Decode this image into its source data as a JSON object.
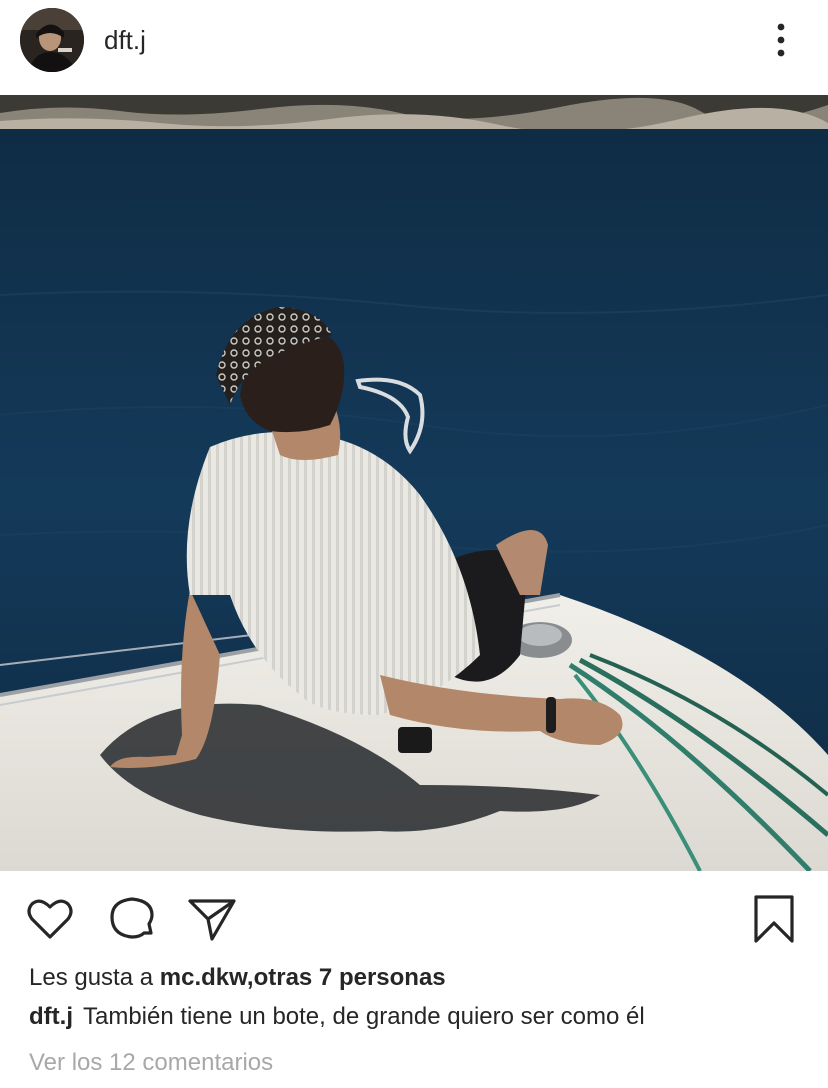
{
  "post": {
    "author": {
      "username": "dft.j",
      "avatar_icon": "profile-photo"
    },
    "menu_icon": "more-vertical-icon",
    "photo": {
      "subject": "post-photo"
    },
    "actions": {
      "like_icon": "heart-icon",
      "comment_icon": "comment-icon",
      "share_icon": "send-icon",
      "save_icon": "bookmark-icon"
    },
    "likes": {
      "prefix": "Les gusta a ",
      "first_user": "mc.dkw",
      "others": ",otras 7 personas"
    },
    "caption": {
      "username": "dft.j",
      "text": "También tiene un bote, de grande quiero ser como él"
    },
    "comments_link": "Ver los 12 comentarios"
  },
  "colors": {
    "text": "#262626",
    "muted": "#a8a8a8",
    "background": "#ffffff",
    "sea": "#14344f"
  }
}
